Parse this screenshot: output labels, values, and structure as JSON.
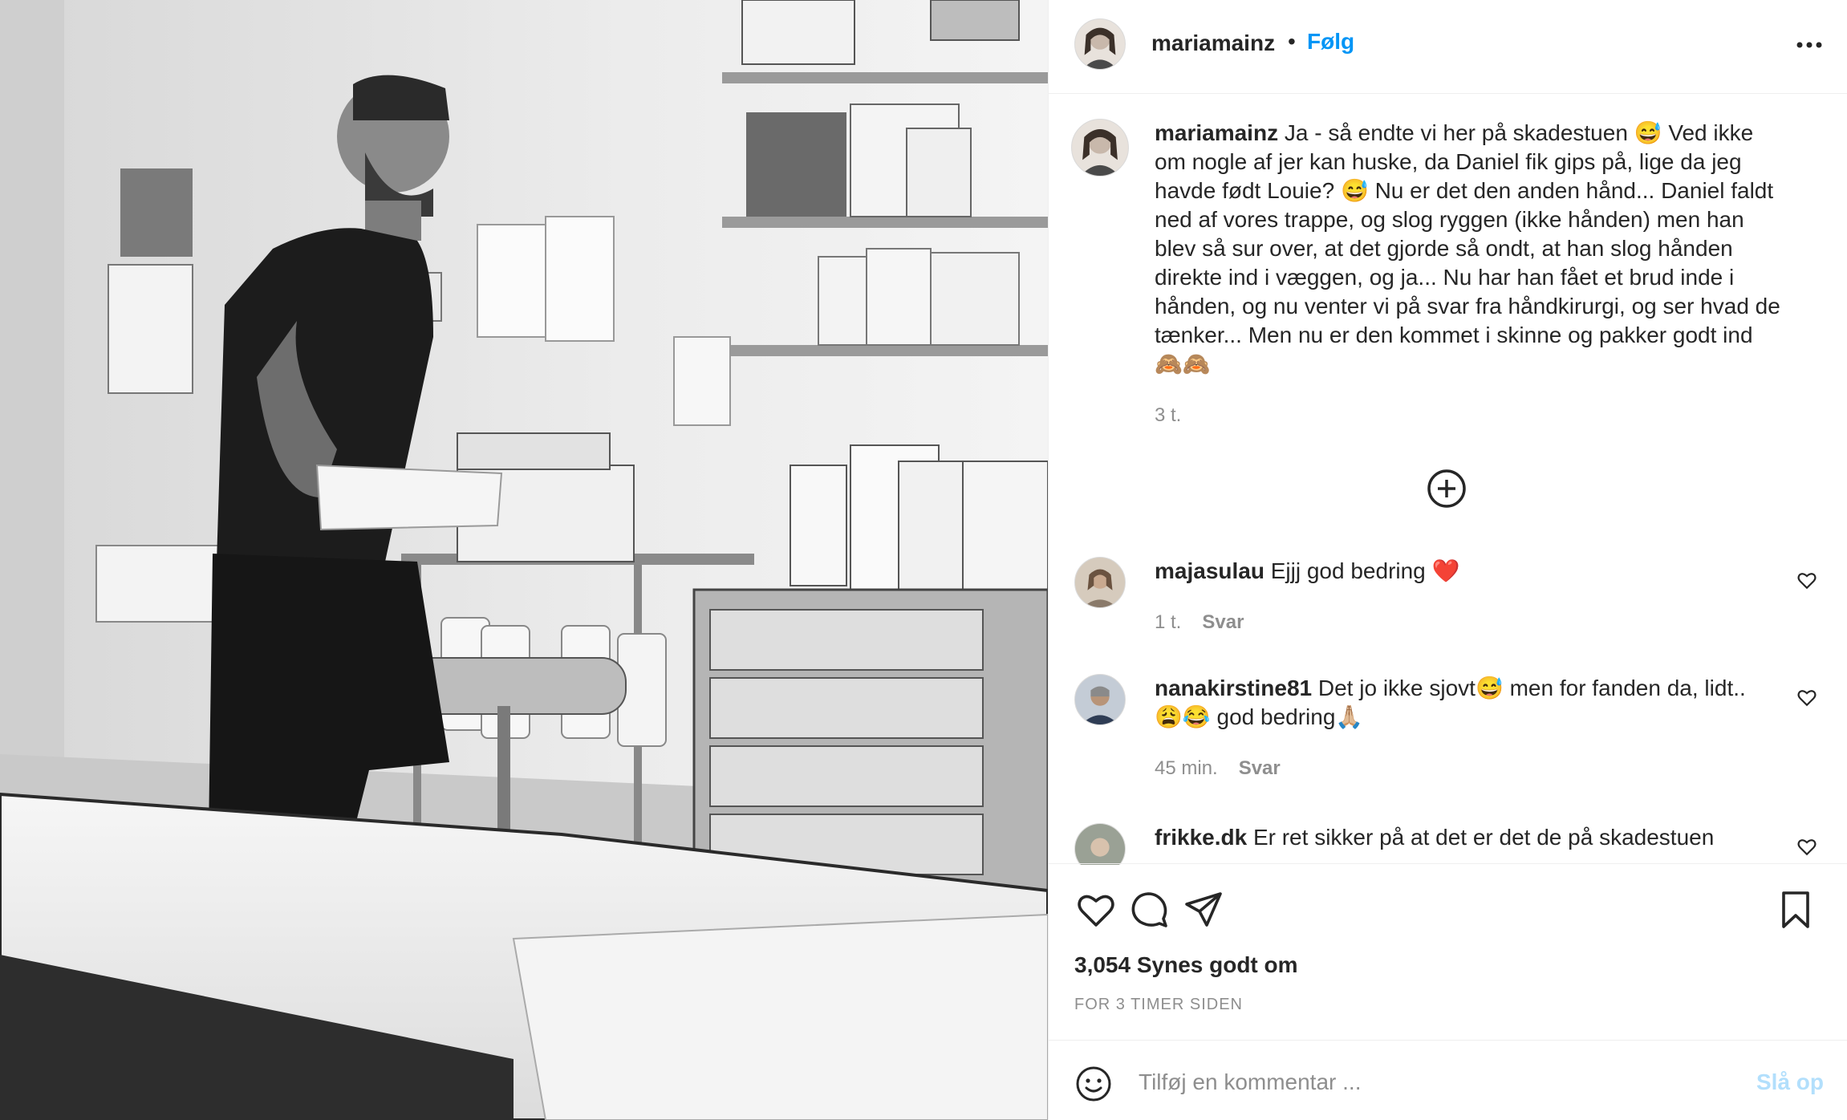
{
  "photo": {
    "alt": "Black and white photo of a man with an arm splint in a hospital emergency room"
  },
  "header": {
    "username": "mariamainz",
    "separator": "•",
    "follow_label": "Følg",
    "more_icon": "more-horizontal-icon"
  },
  "caption": {
    "username": "mariamainz",
    "text_lines": [
      "Ja - så endte vi her på skadestuen 😅 Ved ikke",
      "om nogle af jer kan huske, da Daniel fik gips på, lige da jeg",
      "havde født Louie? 😅 Nu er det den anden hånd... Daniel faldt",
      "ned af vores trappe, og slog ryggen (ikke hånden) men han",
      "blev så sur over, at det gjorde så ondt, at han slog hånden",
      "direkte ind i væggen, og ja... Nu har han fået et brud inde i",
      "hånden, og nu venter vi på svar fra håndkirurgi, og ser hvad de",
      "tænker... Men nu er den kommet i skinne og pakker godt ind",
      "🙈🙈"
    ],
    "time": "3 t."
  },
  "load_more_icon": "plus-circle-icon",
  "comments": [
    {
      "username": "majasulau",
      "text_lines": [
        "Ejjj god bedring ❤️"
      ],
      "time": "1 t.",
      "reply_label": "Svar"
    },
    {
      "username": "nanakirstine81",
      "text_lines": [
        "Det jo ikke sjovt😅 men for fanden da, lidt..",
        "😩😂 god bedring🙏🏼"
      ],
      "time": "45 min.",
      "reply_label": "Svar"
    },
    {
      "username": "frikke.dk",
      "text_lines": [
        "Er ret sikker på at det er det de på skadestuen"
      ],
      "time": "",
      "reply_label": ""
    }
  ],
  "actions": {
    "like_icon": "heart-icon",
    "comment_icon": "comment-icon",
    "share_icon": "paper-plane-icon",
    "save_icon": "bookmark-icon",
    "likes_text": "3,054 Synes godt om",
    "post_time": "FOR 3 TIMER SIDEN"
  },
  "add_comment": {
    "emoji_icon": "emoji-icon",
    "placeholder": "Tilføj en kommentar ...",
    "post_label": "Slå op"
  },
  "colors": {
    "link": "#0095f6",
    "post_disabled": "#b2dffc",
    "muted": "#8e8e8e",
    "like_red": "#ed4956"
  }
}
